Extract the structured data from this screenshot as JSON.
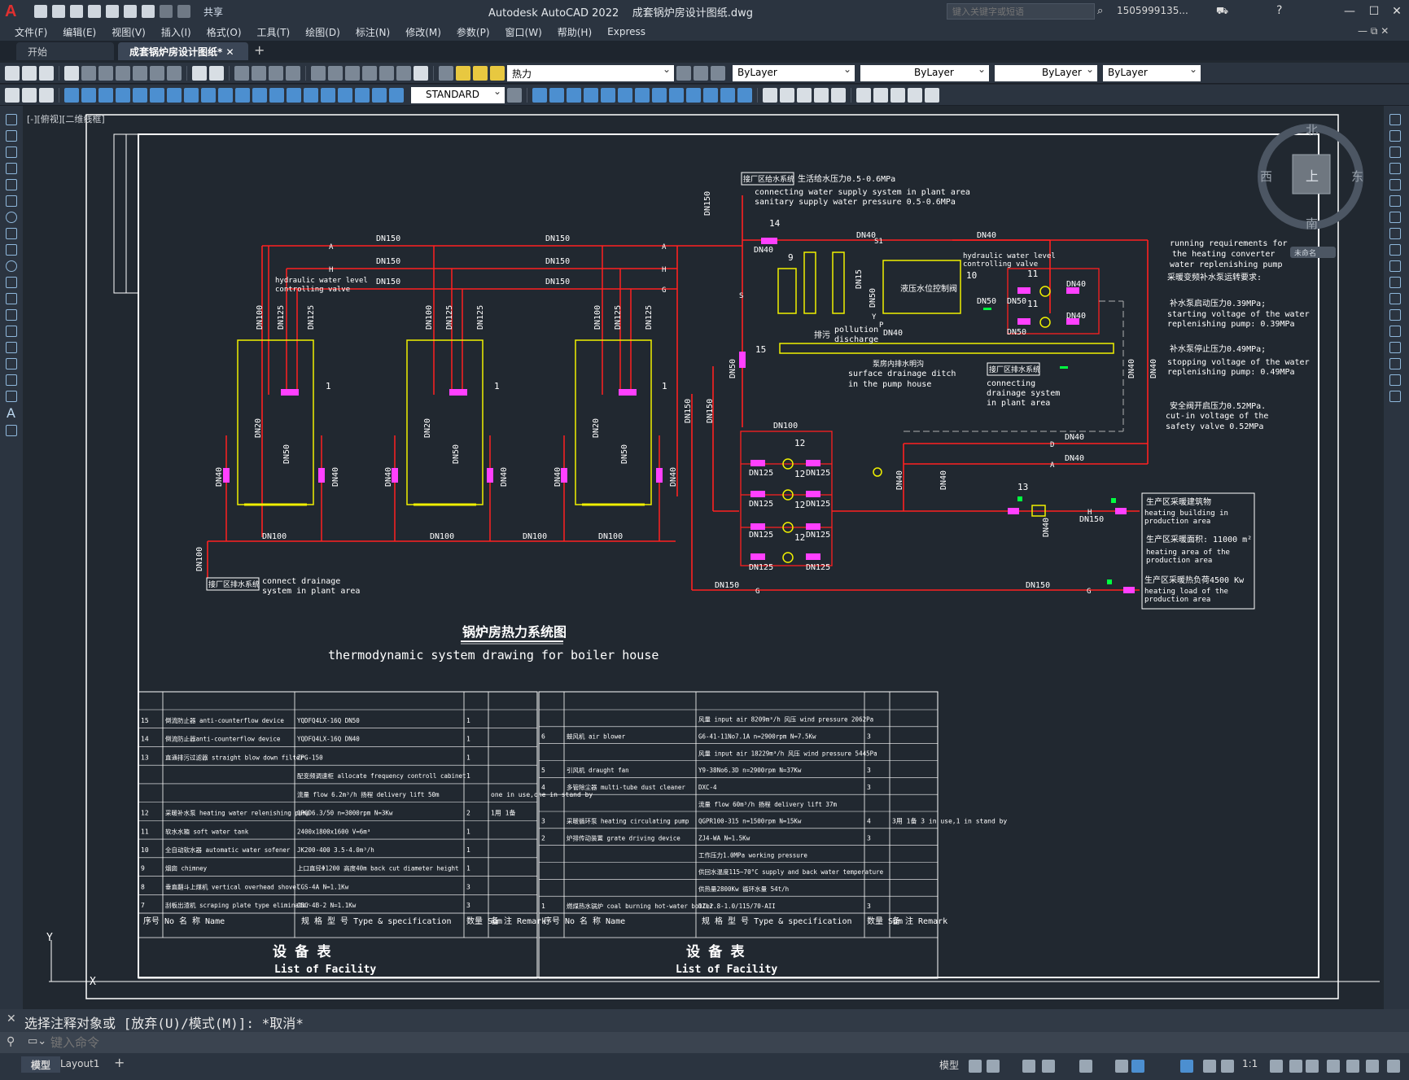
{
  "app": {
    "title": "Autodesk AutoCAD 2022",
    "file": "成套锅炉房设计图纸.dwg",
    "share": "共享",
    "search_placeholder": "键入关键字或短语",
    "user": "1505999135..."
  },
  "menu": [
    "文件(F)",
    "编辑(E)",
    "视图(V)",
    "插入(I)",
    "格式(O)",
    "工具(T)",
    "绘图(D)",
    "标注(N)",
    "修改(M)",
    "参数(P)",
    "窗口(W)",
    "帮助(H)",
    "Express"
  ],
  "tabs": [
    {
      "label": "开始"
    },
    {
      "label": "成套锅炉房设计图纸*"
    }
  ],
  "toolbar": {
    "layer": "热力",
    "color": "ByLayer",
    "linetype": "ByLayer",
    "lineweight": "ByLayer",
    "plotstyle": "ByLayer",
    "textstyle": "STANDARD"
  },
  "viewport_label": "[-][俯视][二维线框]",
  "viewcube": {
    "n": "北",
    "s": "南",
    "e": "东",
    "w": "西",
    "top": "上",
    "wcs": "未命名"
  },
  "drawing": {
    "title_cn": "锅炉房热力系统图",
    "title_en": "thermodynamic system drawing for boiler house",
    "notes": [
      "running requirements for",
      "the heating  converter",
      "water replenishing pump",
      "采暖变频补水泵运转要求:",
      "补水泵启动压力0.39MPa;",
      "starting voltage of the water",
      "replenishing pump: 0.39MPa",
      "补水泵停止压力0.49MPa;",
      "stopping voltage of the water",
      "replenishing pump: 0.49MPa",
      "安全阀开启压力0.52MPa.",
      "cut-in voltage of the",
      "safety valve 0.52MPa"
    ],
    "supply_box": "接厂区给水系统",
    "supply_text": [
      "生活给水压力0.5-0.6MPa",
      "connecting water supply system in plant area",
      "sanitary supply water pressure 0.5-0.6MPa"
    ],
    "drain_box": "接厂区排水系统",
    "drain_text": [
      "connect drainage",
      "system in plant area"
    ],
    "drain_box2": "接厂区排水系统",
    "drain_text2": [
      "connecting",
      "drainage system",
      "in plant area"
    ],
    "ditch_cn": "泵房内排水明沟",
    "ditch_en": [
      "surface drainage ditch",
      "in the pump house"
    ],
    "hwlcv": [
      "hydraulic water level",
      "controlling valve"
    ],
    "valve_box": "液压水位控制阀",
    "pollution": [
      "排污",
      "pollution",
      "discharge"
    ],
    "prod_area": [
      "生产区采暖建筑物",
      "heating building in",
      "production area",
      "生产区采暖面积: 11000 m²",
      "heating area of the",
      "production area",
      "生产区采暖热负荷4500 Kw",
      "heating load of the",
      "production area"
    ],
    "pipe_labels": {
      "dn150": "DN150",
      "dn100": "DN100",
      "dn125": "DN125",
      "dn50": "DN50",
      "dn40": "DN40",
      "dn20": "DN20",
      "dn15": "DN15",
      "a": "A",
      "h": "H",
      "g": "G",
      "s": "S",
      "d": "D",
      "y": "Y",
      "p": "P",
      "s1": "S1"
    },
    "item_nums": [
      "1",
      "9",
      "10",
      "11",
      "12",
      "13",
      "14",
      "15"
    ]
  },
  "table_left": {
    "rows": [
      [
        "15",
        "倒流防止器 anti-counterflow device",
        "YQDFQ4LX-16Q   DN50",
        "1",
        ""
      ],
      [
        "14",
        "倒流防止器anti-counterflow device",
        "YQDFQ4LX-16Q   DN40",
        "1",
        ""
      ],
      [
        "13",
        "直通排污过滤器 straight blow down filter",
        "ZPG-150",
        "1",
        ""
      ],
      [
        "",
        "",
        "配变频调速柜  allocate frequency controll cabinet",
        "1",
        ""
      ],
      [
        "",
        "",
        "流量 flow 6.2m³/h   扬程 delivery lift 50m",
        "",
        "one in use,one in stand by"
      ],
      [
        "12",
        "采暖补水泵 heating water relenishing pump",
        "QPGD6.3/50  n=3000rpm  N=3Kw",
        "2",
        "1用 1备"
      ],
      [
        "11",
        "软水水箱 soft water tank",
        "2400x1800x1600     V=6m³",
        "1",
        ""
      ],
      [
        "10",
        "全自动软水器 automatic water sofener",
        "JK200-400     3.5-4.0m³/h",
        "1",
        ""
      ],
      [
        "9",
        "烟囱 chimney",
        "上口直径Φ1200  高度40m back cut diameter  height",
        "1",
        ""
      ],
      [
        "8",
        "垂直翻斗上煤机 vertical overhead shovel",
        "CGS-4A        N=1.1Kw",
        "3",
        ""
      ],
      [
        "7",
        "刮板出渣机 scraping plate type eliminator",
        "GBC-4B-2      N=1.1Kw",
        "3",
        ""
      ]
    ],
    "hdr": [
      "序号 No",
      "名    称 Name",
      "规 格 型 号 Type & specification",
      "数量 Sum",
      "备 注 Remark"
    ],
    "title_cn": "设    备    表",
    "title_en": "List of Facility"
  },
  "table_right": {
    "rows": [
      [
        "",
        "",
        "风量 input air 8209m³/h   风压 wind pressure 2062Pa",
        "",
        ""
      ],
      [
        "6",
        "鼓风机 air blower",
        "G6-41-11No7.1A    n=2900rpm   N=7.5Kw",
        "3",
        ""
      ],
      [
        "",
        "",
        "风量 input air 18229m³/h  风压 wind pressure 5445Pa",
        "",
        ""
      ],
      [
        "5",
        "引风机 draught fan",
        "Y9-38No6.3D    n=2900rpm  N=37Kw",
        "3",
        ""
      ],
      [
        "4",
        "多管除尘器 multi-tube dust cleaner",
        "DXC-4",
        "3",
        ""
      ],
      [
        "",
        "",
        "流量 flow 60m³/h   扬程 delivery lift 37m",
        "",
        ""
      ],
      [
        "3",
        "采暖循环泵 heating circulating pump",
        "QGPR100-315  n=1500rpm  N=15Kw",
        "4",
        "3用 1备 3 in use,1 in stand by"
      ],
      [
        "2",
        "炉排传动装置 grate driving device",
        "ZJ4-WA   N=1.5Kw",
        "3",
        ""
      ],
      [
        "",
        "",
        "工作压力1.0MPa working pressure",
        "",
        ""
      ],
      [
        "",
        "",
        "供回水温度115~70°C supply and back water temperature",
        "",
        ""
      ],
      [
        "",
        "",
        "供热量2800Kw   循环水量 54t/h",
        "",
        ""
      ],
      [
        "1",
        "燃煤热水锅炉 coal burning hot-water boiler",
        "DZL2.8-1.0/115/70-AII",
        "3",
        ""
      ]
    ],
    "title_cn": "设    备    表",
    "title_en": "List of Facility"
  },
  "command": {
    "history": "选择注释对象或 [放弃(U)/模式(M)]: *取消*",
    "placeholder": "键入命令"
  },
  "status": {
    "layout_tabs": [
      "模型",
      "Layout1"
    ],
    "model_label": "模型",
    "scale": "1:1"
  },
  "colors": {
    "pipe": "#ff2020",
    "equipment": "#f0f000",
    "frame": "#ffffff",
    "dashed": "#c0c0c0",
    "green": "#00ff40",
    "magenta": "#ff40ff"
  }
}
